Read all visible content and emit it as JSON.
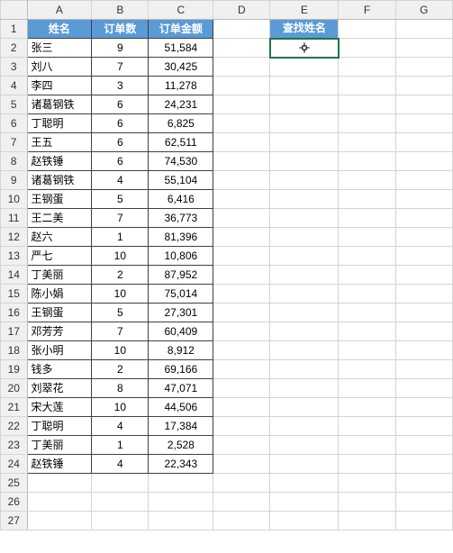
{
  "columns": [
    "A",
    "B",
    "C",
    "D",
    "E",
    "F",
    "G"
  ],
  "colClasses": [
    "w-a",
    "w-b",
    "w-c",
    "w-d",
    "w-e",
    "w-f",
    "w-g"
  ],
  "rowCount": 27,
  "headers": {
    "name": "姓名",
    "orders": "订单数",
    "amount": "订单金额"
  },
  "lookupHeader": "查找姓名",
  "activeCell": {
    "row": 2,
    "col": "E"
  },
  "cursorIcon": "cell-select-cursor",
  "tableRows": [
    {
      "name": "张三",
      "orders": 9,
      "amount": "51,584"
    },
    {
      "name": "刘八",
      "orders": 7,
      "amount": "30,425"
    },
    {
      "name": "李四",
      "orders": 3,
      "amount": "11,278"
    },
    {
      "name": "诸葛钢铁",
      "orders": 6,
      "amount": "24,231"
    },
    {
      "name": "丁聪明",
      "orders": 6,
      "amount": "6,825"
    },
    {
      "name": "王五",
      "orders": 6,
      "amount": "62,511"
    },
    {
      "name": "赵铁锤",
      "orders": 6,
      "amount": "74,530"
    },
    {
      "name": "诸葛钢铁",
      "orders": 4,
      "amount": "55,104"
    },
    {
      "name": "王钢蛋",
      "orders": 5,
      "amount": "6,416"
    },
    {
      "name": "王二美",
      "orders": 7,
      "amount": "36,773"
    },
    {
      "name": "赵六",
      "orders": 1,
      "amount": "81,396"
    },
    {
      "name": "严七",
      "orders": 10,
      "amount": "10,806"
    },
    {
      "name": "丁美丽",
      "orders": 2,
      "amount": "87,952"
    },
    {
      "name": "陈小娟",
      "orders": 10,
      "amount": "75,014"
    },
    {
      "name": "王钢蛋",
      "orders": 5,
      "amount": "27,301"
    },
    {
      "name": "邓芳芳",
      "orders": 7,
      "amount": "60,409"
    },
    {
      "name": "张小明",
      "orders": 10,
      "amount": "8,912"
    },
    {
      "name": "钱多",
      "orders": 2,
      "amount": "69,166"
    },
    {
      "name": "刘翠花",
      "orders": 8,
      "amount": "47,071"
    },
    {
      "name": "宋大莲",
      "orders": 10,
      "amount": "44,506"
    },
    {
      "name": "丁聪明",
      "orders": 4,
      "amount": "17,384"
    },
    {
      "name": "丁美丽",
      "orders": 1,
      "amount": "2,528"
    },
    {
      "name": "赵铁锤",
      "orders": 4,
      "amount": "22,343"
    }
  ],
  "chart_data": {
    "type": "table",
    "title": "订单金额",
    "columns": [
      "姓名",
      "订单数",
      "订单金额"
    ],
    "rows": [
      [
        "张三",
        9,
        51584
      ],
      [
        "刘八",
        7,
        30425
      ],
      [
        "李四",
        3,
        11278
      ],
      [
        "诸葛钢铁",
        6,
        24231
      ],
      [
        "丁聪明",
        6,
        6825
      ],
      [
        "王五",
        6,
        62511
      ],
      [
        "赵铁锤",
        6,
        74530
      ],
      [
        "诸葛钢铁",
        4,
        55104
      ],
      [
        "王钢蛋",
        5,
        6416
      ],
      [
        "王二美",
        7,
        36773
      ],
      [
        "赵六",
        1,
        81396
      ],
      [
        "严七",
        10,
        10806
      ],
      [
        "丁美丽",
        2,
        87952
      ],
      [
        "陈小娟",
        10,
        75014
      ],
      [
        "王钢蛋",
        5,
        27301
      ],
      [
        "邓芳芳",
        7,
        60409
      ],
      [
        "张小明",
        10,
        8912
      ],
      [
        "钱多",
        2,
        69166
      ],
      [
        "刘翠花",
        8,
        47071
      ],
      [
        "宋大莲",
        10,
        44506
      ],
      [
        "丁聪明",
        4,
        17384
      ],
      [
        "丁美丽",
        1,
        2528
      ],
      [
        "赵铁锤",
        4,
        22343
      ]
    ]
  }
}
